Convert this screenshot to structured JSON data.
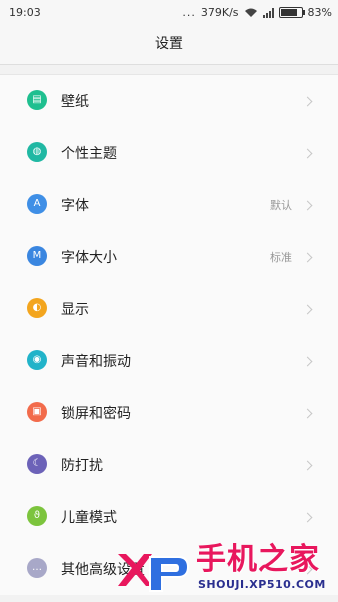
{
  "status": {
    "time": "19:03",
    "dots": "...",
    "speed": "379K/s",
    "battery": "83%",
    "battery_level": 0.83
  },
  "header": {
    "title": "设置"
  },
  "settings": [
    {
      "label": "壁纸",
      "value": "",
      "icon": "wallpaper-icon",
      "color": "#1fbf8f",
      "glyph": "▤"
    },
    {
      "label": "个性主题",
      "value": "",
      "icon": "theme-icon",
      "color": "#20b8a3",
      "glyph": "◍"
    },
    {
      "label": "字体",
      "value": "默认",
      "icon": "font-icon",
      "color": "#3f8fe6",
      "glyph": "A"
    },
    {
      "label": "字体大小",
      "value": "标准",
      "icon": "font-size-icon",
      "color": "#3a86e0",
      "glyph": "M"
    },
    {
      "label": "显示",
      "value": "",
      "icon": "display-icon",
      "color": "#f3a51e",
      "glyph": "◐"
    },
    {
      "label": "声音和振动",
      "value": "",
      "icon": "sound-icon",
      "color": "#21b3c9",
      "glyph": "◉"
    },
    {
      "label": "锁屏和密码",
      "value": "",
      "icon": "lock-icon",
      "color": "#f26b4b",
      "glyph": "▣"
    },
    {
      "label": "防打扰",
      "value": "",
      "icon": "moon-icon",
      "color": "#6c62b8",
      "glyph": "☾"
    },
    {
      "label": "儿童模式",
      "value": "",
      "icon": "child-mode-icon",
      "color": "#7cc43d",
      "glyph": "ϑ"
    },
    {
      "label": "其他高级设置",
      "value": "",
      "icon": "more-icon",
      "color": "#a8a8c8",
      "glyph": "…"
    }
  ],
  "watermark": {
    "title": "手机之家",
    "url": "SHOUJI.XP510.COM",
    "logo": "XP"
  }
}
